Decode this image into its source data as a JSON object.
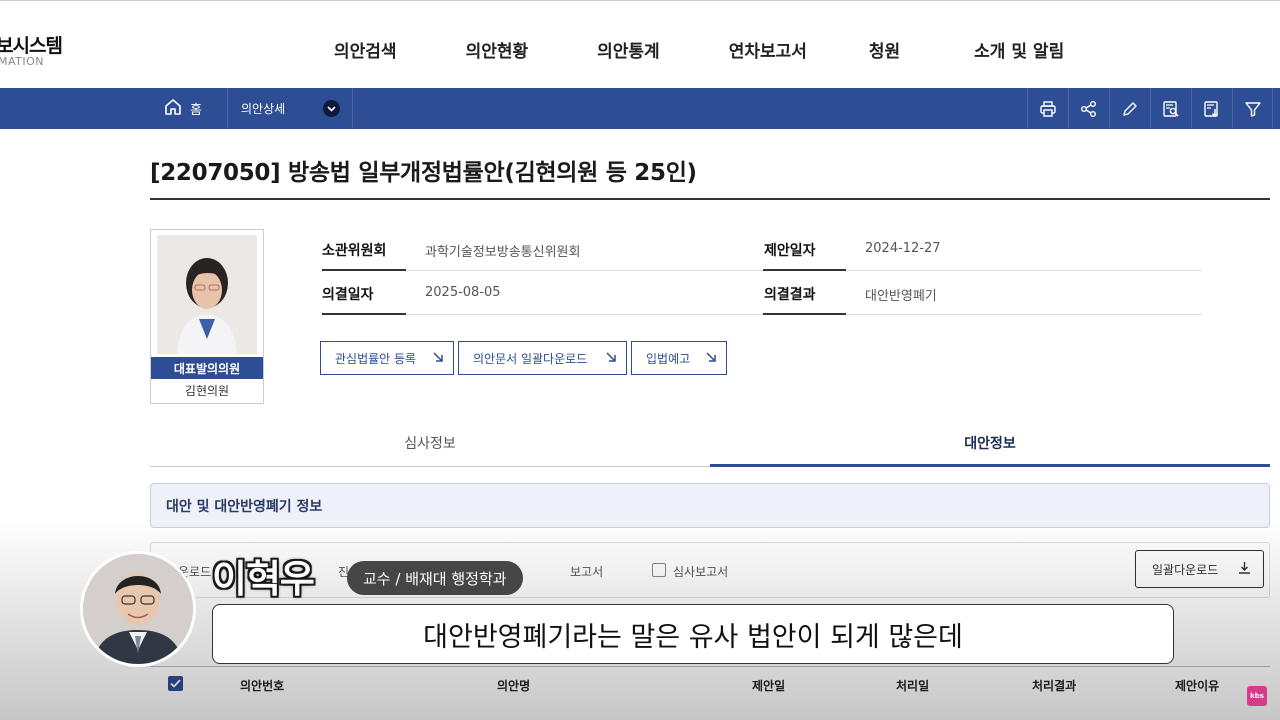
{
  "header": {
    "logo_main": "보시스템",
    "logo_sub": "MATION",
    "nav": [
      "의안검색",
      "의안현황",
      "의안통계",
      "연차보고서",
      "청원",
      "소개 및 알림"
    ]
  },
  "navbar": {
    "home_label": "홈",
    "breadcrumb": "의안상세",
    "tools": [
      "print-icon",
      "share-icon",
      "edit-icon",
      "search-document-icon",
      "download-document-icon",
      "filter-icon"
    ]
  },
  "bill": {
    "title": "[2207050] 방송법 일부개정법률안(김현의원 등 25인)",
    "committee_label": "소관위원회",
    "committee_value": "과학기술정보방송통신위원회",
    "proposal_date_label": "제안일자",
    "proposal_date_value": "2024-12-27",
    "decision_date_label": "의결일자",
    "decision_date_value": "2025-08-05",
    "decision_result_label": "의결결과",
    "decision_result_value": "대안반영폐기"
  },
  "member": {
    "role": "대표발의의원",
    "name": "김현의원"
  },
  "actions": {
    "register": "관심법률안 등록",
    "download_all_docs": "의안문서 일괄다운로드",
    "legislative_notice": "입법예고"
  },
  "tabs": {
    "review": "심사정보",
    "alternative": "대안정보"
  },
  "section": {
    "title": "대안 및 대안반영폐기 정보",
    "filter_prefix": "운로드",
    "filter_mid": "진",
    "filter_report": "보고서",
    "filter_review_report": "심사보고서",
    "bulk_download": "일괄다운로드"
  },
  "table": {
    "headers": [
      "의안번호",
      "의안명",
      "제안일",
      "처리일",
      "처리결과",
      "제안이유"
    ]
  },
  "overlay": {
    "speaker_name": "이혁우",
    "speaker_role": "교수 / 배재대 행정학과",
    "subtitle": "대안반영폐기라는 말은 유사 법안이 되게 많은데",
    "watermark": "kbs"
  },
  "colors": {
    "primary": "#2d4d94",
    "section_bg": "#eef1f7"
  }
}
